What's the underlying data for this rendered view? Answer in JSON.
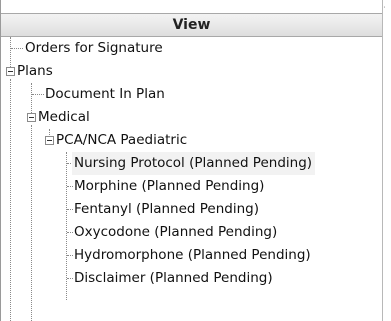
{
  "panel": {
    "header": "View"
  },
  "tree": {
    "orders_for_signature": "Orders for Signature",
    "plans": "Plans",
    "document_in_plan": "Document In Plan",
    "medical": "Medical",
    "pca_nca_paediatric": "PCA/NCA Paediatric",
    "children": [
      "Nursing Protocol (Planned Pending)",
      "Morphine (Planned Pending)",
      "Fentanyl (Planned Pending)",
      "Oxycodone (Planned Pending)",
      "Hydromorphone (Planned Pending)",
      "Disclaimer (Planned Pending)"
    ]
  }
}
